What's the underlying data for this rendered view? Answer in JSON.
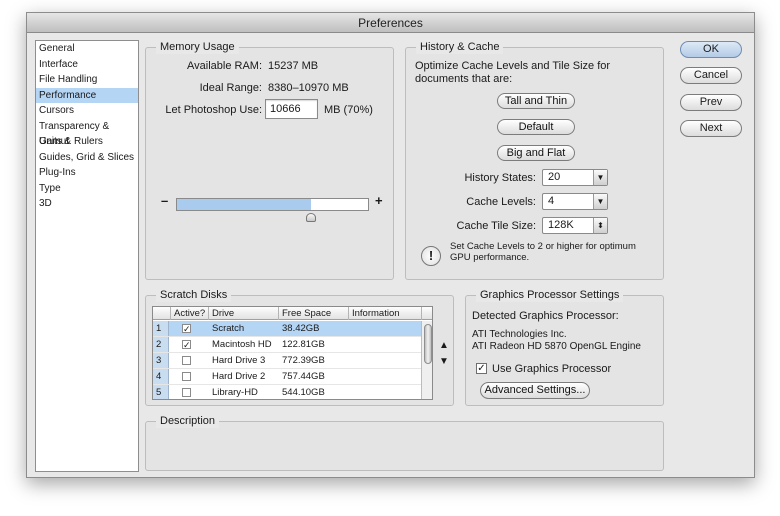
{
  "window": {
    "title": "Preferences"
  },
  "sidebar": {
    "items": [
      {
        "label": "General"
      },
      {
        "label": "Interface"
      },
      {
        "label": "File Handling"
      },
      {
        "label": "Performance",
        "selected": true
      },
      {
        "label": "Cursors"
      },
      {
        "label": "Transparency & Gamut"
      },
      {
        "label": "Units & Rulers"
      },
      {
        "label": "Guides, Grid & Slices"
      },
      {
        "label": "Plug-Ins"
      },
      {
        "label": "Type"
      },
      {
        "label": "3D"
      }
    ]
  },
  "memory": {
    "title": "Memory Usage",
    "available_label": "Available RAM:",
    "available_value": "15237 MB",
    "ideal_label": "Ideal Range:",
    "ideal_value": "8380–10970 MB",
    "let_label": "Let Photoshop Use:",
    "let_value": "10666",
    "let_suffix": "MB (70%)",
    "slider_minus": "–",
    "slider_plus": "+",
    "slider_fraction": 0.7
  },
  "history": {
    "title": "History & Cache",
    "description": "Optimize Cache Levels and Tile Size for documents that are:",
    "presets": [
      "Tall and Thin",
      "Default",
      "Big and Flat"
    ],
    "history_states_label": "History States:",
    "history_states_value": "20",
    "cache_levels_label": "Cache Levels:",
    "cache_levels_value": "4",
    "tile_size_label": "Cache Tile Size:",
    "tile_size_value": "128K",
    "note": "Set Cache Levels to 2 or higher for optimum GPU performance."
  },
  "scratch": {
    "title": "Scratch Disks",
    "columns": [
      "Active?",
      "Drive",
      "Free Space",
      "Information"
    ],
    "rows": [
      {
        "index": "1",
        "active": true,
        "drive": "Scratch",
        "free": "38.42GB",
        "info": ""
      },
      {
        "index": "2",
        "active": true,
        "drive": "Macintosh HD",
        "free": "122.81GB",
        "info": ""
      },
      {
        "index": "3",
        "active": false,
        "drive": "Hard Drive 3",
        "free": "772.39GB",
        "info": ""
      },
      {
        "index": "4",
        "active": false,
        "drive": "Hard Drive 2",
        "free": "757.44GB",
        "info": ""
      },
      {
        "index": "5",
        "active": false,
        "drive": "Library-HD",
        "free": "544.10GB",
        "info": ""
      }
    ],
    "move_up": "▲",
    "move_down": "▼"
  },
  "gpu": {
    "title": "Graphics Processor Settings",
    "detected_label": "Detected Graphics Processor:",
    "vendor": "ATI Technologies Inc.",
    "model": "ATI Radeon HD 5870 OpenGL Engine",
    "use_label": "Use Graphics Processor",
    "use_checked": true,
    "advanced_label": "Advanced Settings..."
  },
  "description": {
    "title": "Description"
  },
  "buttons": {
    "ok": "OK",
    "cancel": "Cancel",
    "prev": "Prev",
    "next": "Next"
  },
  "glyphs": {
    "check": "✓",
    "warn": "!",
    "down": "▼",
    "updown": "⬍"
  }
}
